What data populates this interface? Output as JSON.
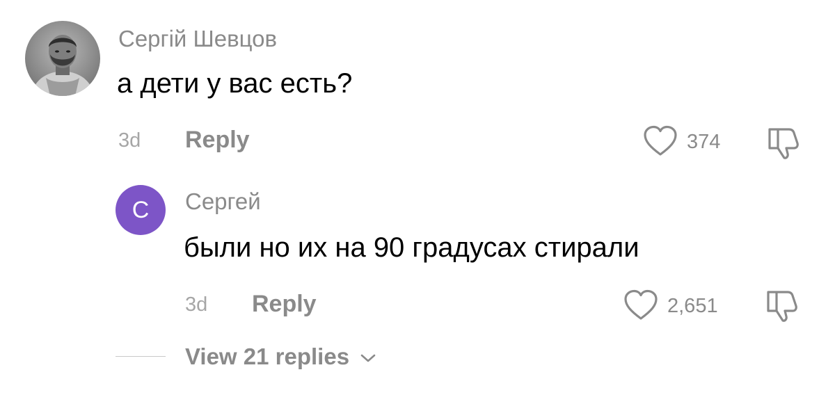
{
  "comment": {
    "author": "Сергій Шевцов",
    "text": "а дети у вас есть?",
    "time": "3d",
    "reply_label": "Reply",
    "likes": "374",
    "avatar_icon": "user-photo",
    "like_icon": "heart-outline-icon",
    "dislike_icon": "thumbs-down-outline-icon"
  },
  "reply": {
    "author": "Сергей",
    "avatar_letter": "С",
    "avatar_color": "#7d55c7",
    "text": "были но их на 90 градусах стирали",
    "time": "3d",
    "reply_label": "Reply",
    "likes": "2,651",
    "like_icon": "heart-outline-icon",
    "dislike_icon": "thumbs-down-outline-icon"
  },
  "view_replies": {
    "label": "View 21 replies",
    "icon": "chevron-down-icon"
  }
}
